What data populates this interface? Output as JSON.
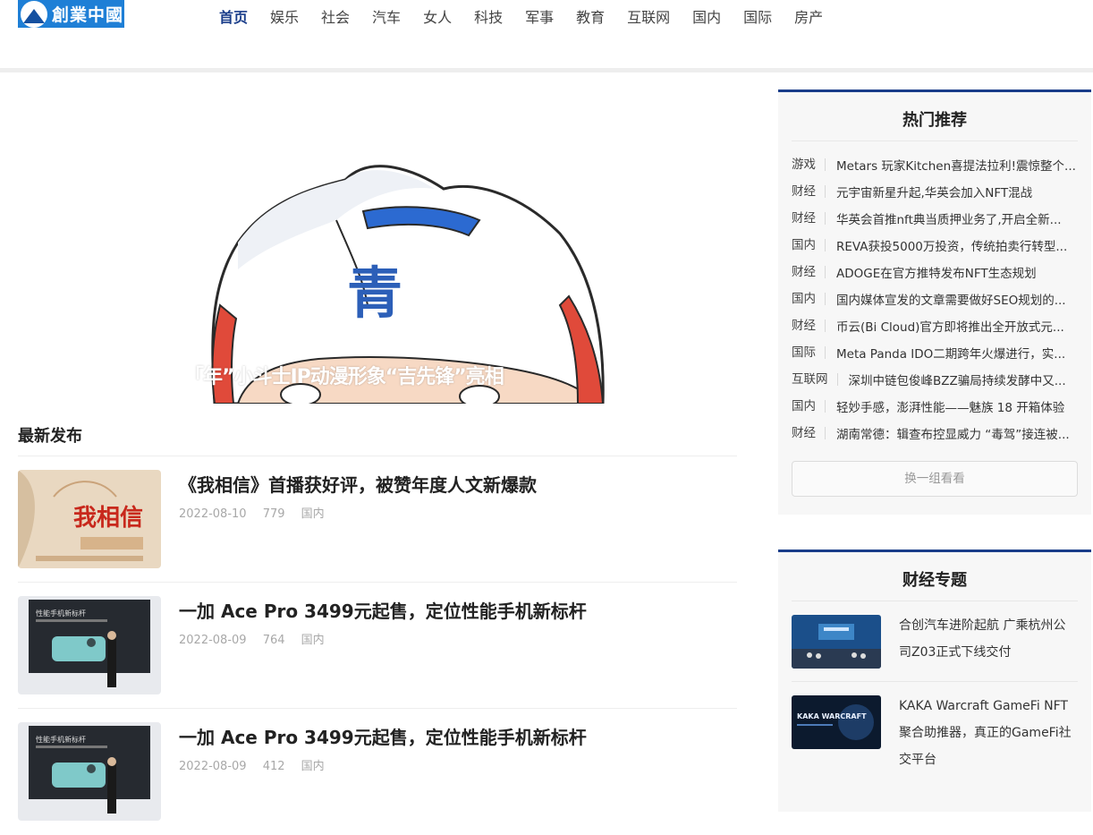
{
  "header": {
    "logo_text": "創業中國",
    "nav": [
      {
        "label": "首页",
        "active": true
      },
      {
        "label": "娱乐",
        "active": false
      },
      {
        "label": "社会",
        "active": false
      },
      {
        "label": "汽车",
        "active": false
      },
      {
        "label": "女人",
        "active": false
      },
      {
        "label": "科技",
        "active": false
      },
      {
        "label": "军事",
        "active": false
      },
      {
        "label": "教育",
        "active": false
      },
      {
        "label": "互联网",
        "active": false
      },
      {
        "label": "国内",
        "active": false
      },
      {
        "label": "国际",
        "active": false
      },
      {
        "label": "房产",
        "active": false
      }
    ]
  },
  "hero": {
    "caption": "「年”小斗士IP动漫形象“吉先锋”亮相",
    "helmet_char": "青"
  },
  "latest": {
    "title": "最新发布",
    "articles": [
      {
        "title": "《我相信》首播获好评，被赞年度人文新爆款",
        "date": "2022-08-10",
        "views": "779",
        "category": "国内",
        "thumb_text": "我相信"
      },
      {
        "title": "一加 Ace Pro 3499元起售，定位性能手机新标杆",
        "date": "2022-08-09",
        "views": "764",
        "category": "国内",
        "thumb_text": "性能手机新标杆"
      },
      {
        "title": "一加 Ace Pro 3499元起售，定位性能手机新标杆",
        "date": "2022-08-09",
        "views": "412",
        "category": "国内",
        "thumb_text": "性能手机新标杆"
      }
    ]
  },
  "sidebar": {
    "hot": {
      "title": "热门推荐",
      "items": [
        {
          "cat": "游戏",
          "text": "Metars 玩家Kitchen喜提法拉利!震惊整个..."
        },
        {
          "cat": "财经",
          "text": "元宇宙新星升起,华英会加入NFT混战"
        },
        {
          "cat": "财经",
          "text": "华英会首推nft典当质押业务了,开启全新..."
        },
        {
          "cat": "国内",
          "text": "REVA获投5000万投资，传统拍卖行转型..."
        },
        {
          "cat": "财经",
          "text": "ADOGE在官方推特发布NFT生态规划"
        },
        {
          "cat": "国内",
          "text": "国内媒体宣发的文章需要做好SEO规划的..."
        },
        {
          "cat": "财经",
          "text": "币云(Bi Cloud)官方即将推出全开放式元..."
        },
        {
          "cat": "国际",
          "text": "Meta Panda IDO二期跨年火爆进行，实..."
        },
        {
          "cat": "互联网",
          "text": "深圳中链包俊峰BZZ骗局持续发酵中又..."
        },
        {
          "cat": "国内",
          "text": "轻妙手感，澎湃性能——魅族 18 开箱体验"
        },
        {
          "cat": "财经",
          "text": "湖南常德：辑查布控显威力 “毒驾”接连被..."
        }
      ],
      "refresh_label": "换一组看看"
    },
    "finance": {
      "title": "财经专题",
      "items": [
        {
          "text": "合创汽车进阶起航 广乘杭州公司Z03正式下线交付"
        },
        {
          "text": "KAKA Warcraft GameFi NFT聚合助推器，真正的GameFi社交平台",
          "thumb_text": "KAKA WARCRAFT"
        }
      ]
    }
  }
}
